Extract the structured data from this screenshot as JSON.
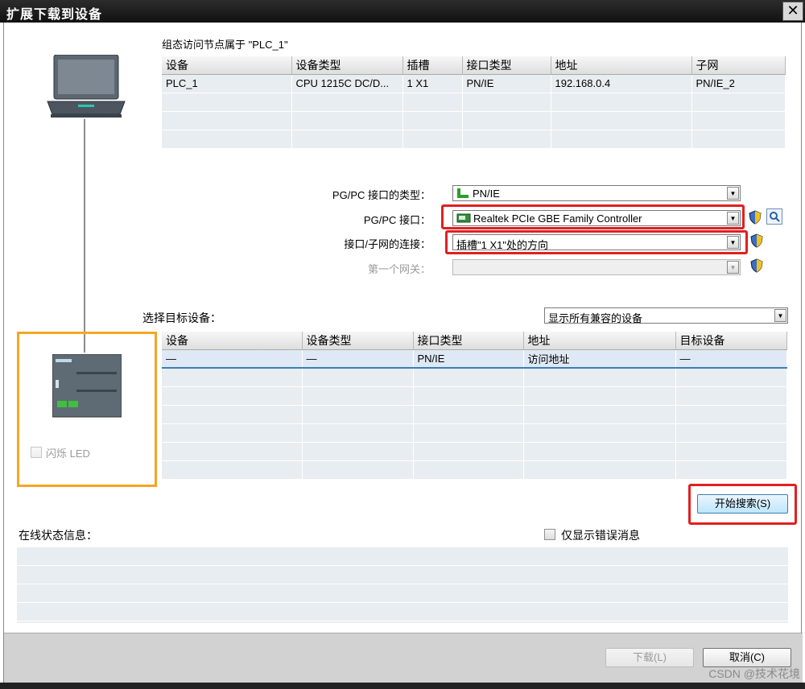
{
  "window": {
    "title": "扩展下载到设备",
    "close_glyph": "✕"
  },
  "config_table": {
    "caption": "组态访问节点属于 \"PLC_1\"",
    "columns": [
      "设备",
      "设备类型",
      "插槽",
      "接口类型",
      "地址",
      "子网"
    ],
    "rows": [
      [
        "PLC_1",
        "CPU 1215C DC/D...",
        "1 X1",
        "PN/IE",
        "192.168.0.4",
        "PN/IE_2"
      ]
    ]
  },
  "settings": {
    "pgpc_type_label": "PG/PC 接口的类型：",
    "pgpc_type_value": "PN/IE",
    "pgpc_if_label": "PG/PC 接口：",
    "pgpc_if_value": "Realtek PCIe GBE Family Controller",
    "subnet_label": "接口/子网的连接：",
    "subnet_value": "插槽\"1 X1\"处的方向",
    "gateway_label": "第一个网关：",
    "gateway_value": ""
  },
  "target": {
    "label": "选择目标设备：",
    "filter_value": "显示所有兼容的设备",
    "columns": [
      "设备",
      "设备类型",
      "接口类型",
      "地址",
      "目标设备"
    ],
    "rows": [
      [
        "—",
        "—",
        "PN/IE",
        "访问地址",
        "—"
      ]
    ]
  },
  "left_panel": {
    "flash_led_label": "闪烁 LED"
  },
  "search_button": "开始搜索(S)",
  "status": {
    "label": "在线状态信息：",
    "errors_only_label": "仅显示错误消息"
  },
  "buttons": {
    "download": "下载(L)",
    "cancel": "取消(C)"
  },
  "watermark": "CSDN @技术花境",
  "colors": {
    "highlight_red": "#e02020",
    "highlight_orange": "#f5a623",
    "selected_row": "#dfe9f5"
  }
}
